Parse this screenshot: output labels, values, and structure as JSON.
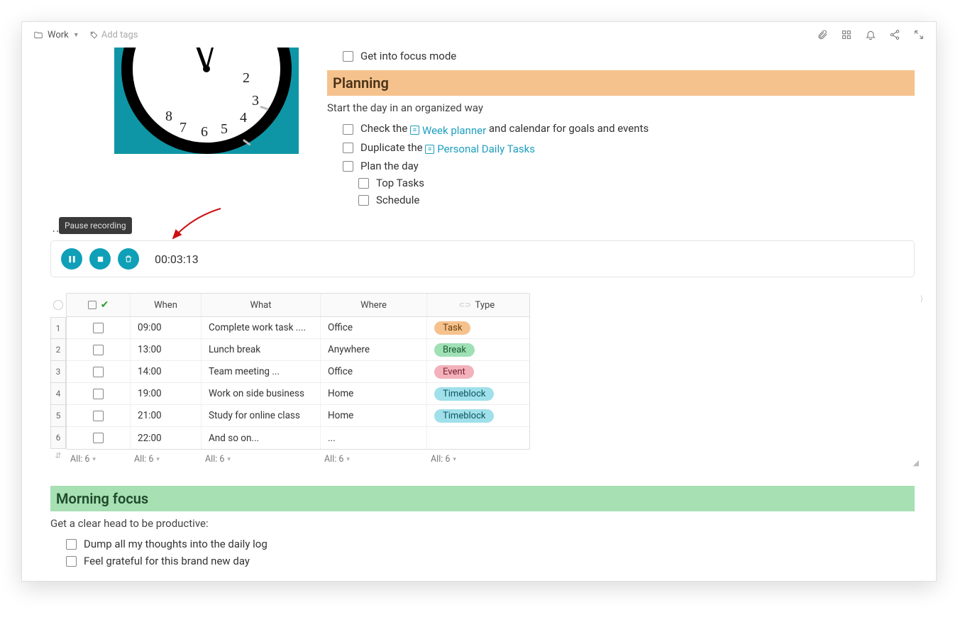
{
  "topbar": {
    "folder_label": "Work",
    "add_tags_label": "Add tags"
  },
  "focus_item": "Get into focus mode",
  "planning": {
    "heading": "Planning",
    "subtitle": "Start the day in an organized way",
    "items": {
      "check_pre": "Check the ",
      "week_planner": "Week planner",
      "check_post": " and calendar for goals and events",
      "dup_pre": "Duplicate the ",
      "personal_daily": "Personal Daily Tasks",
      "plan_day": "Plan the day",
      "top_tasks": "Top Tasks",
      "schedule": "Schedule"
    }
  },
  "recording": {
    "tooltip": "Pause recording",
    "timer": "00:03:13"
  },
  "table": {
    "columns": {
      "when": "When",
      "what": "What",
      "where": "Where",
      "type": "Type"
    },
    "rows": [
      {
        "n": "1",
        "when": "09:00",
        "what": "Complete work task ....",
        "where": "Office",
        "type": "Task",
        "cls": "task"
      },
      {
        "n": "2",
        "when": "13:00",
        "what": "Lunch break",
        "where": "Anywhere",
        "type": "Break",
        "cls": "break"
      },
      {
        "n": "3",
        "when": "14:00",
        "what": "Team meeting ...",
        "where": "Office",
        "type": "Event",
        "cls": "event"
      },
      {
        "n": "4",
        "when": "19:00",
        "what": "Work on side business",
        "where": "Home",
        "type": "Timeblock",
        "cls": "tb"
      },
      {
        "n": "5",
        "when": "21:00",
        "what": "Study for online class",
        "where": "Home",
        "type": "Timeblock",
        "cls": "tb"
      },
      {
        "n": "6",
        "when": "22:00",
        "what": "And so on...",
        "where": "...",
        "type": "",
        "cls": ""
      }
    ],
    "footer_label": "All: 6"
  },
  "morning": {
    "heading": "Morning focus",
    "subtitle": "Get a clear head to be productive:",
    "items": [
      "Dump all my thoughts into the daily log",
      "Feel grateful for this brand new day"
    ]
  }
}
